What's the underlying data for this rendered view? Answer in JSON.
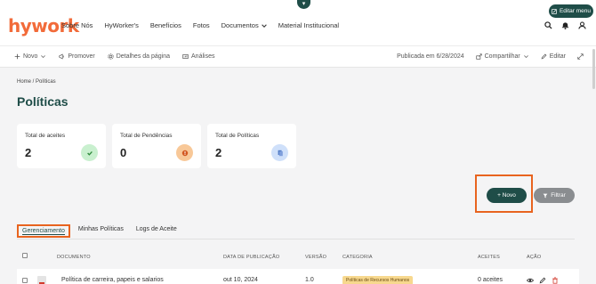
{
  "header": {
    "logo": "hywork",
    "nav": [
      "Sobre Nós",
      "HyWorker's",
      "Benefícios",
      "Fotos",
      "Documentos",
      "Material Institucional"
    ],
    "edit_menu": "Editar menu"
  },
  "pagebar": {
    "novo": "Novo",
    "promover": "Promover",
    "detalhes": "Detalhes da página",
    "analises": "Análises",
    "publicada": "Publicada em 6/28/2024",
    "compartilhar": "Compartilhar",
    "editar": "Editar"
  },
  "breadcrumb": "Home / Políticas",
  "title": "Políticas",
  "cards": [
    {
      "label": "Total de aceites",
      "value": "2",
      "color": "#c9f0cf",
      "icon": "check-icon"
    },
    {
      "label": "Total de Pendências",
      "value": "0",
      "color": "#f8c898",
      "icon": "alert-icon"
    },
    {
      "label": "Total de Políticas",
      "value": "2",
      "color": "#cfe0fa",
      "icon": "document-icon"
    }
  ],
  "actions": {
    "novo": "+ Novo",
    "filtrar": "Filtrar"
  },
  "tabs": [
    "Gerenciamento",
    "Minhas Políticas",
    "Logs de Aceite"
  ],
  "table": {
    "headers": [
      "DOCUMENTO",
      "DATA DE PUBLICAÇÃO",
      "VERSÃO",
      "CATEGORIA",
      "ACEITES",
      "AÇÃO"
    ],
    "rows": [
      {
        "documento": "Política de carreira, papeis e salarios",
        "data": "out 10, 2024",
        "versao": "1.0",
        "categoria": "Políticas de Recursos Humanos",
        "aceites": "0 aceites"
      }
    ]
  },
  "colors": {
    "brand": "#1f4d48",
    "logo": "#f26b3a",
    "highlight": "#e8641f"
  }
}
